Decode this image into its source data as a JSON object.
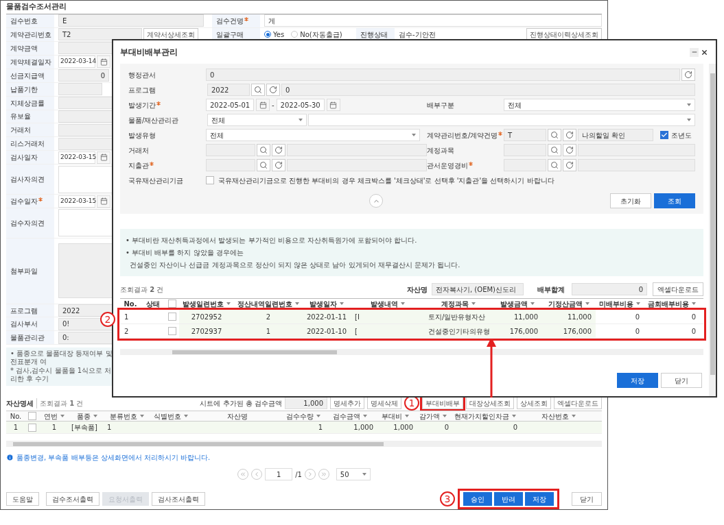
{
  "window": {
    "title": "물품검수조서관리"
  },
  "header_rows": [
    {
      "label": "검수번호",
      "value": "E",
      "right_label": "검수건명",
      "right_required": true,
      "right_value": "게"
    },
    {
      "label": "계약관리번호",
      "value": "T2",
      "button": "계약서상세조회",
      "right_label": "일괄구매",
      "options": [
        {
          "label": "Yes",
          "selected": true
        },
        {
          "label": "No(자동출급)",
          "selected": false
        }
      ],
      "status_label": "진행상태",
      "status_value": "검수-기안전",
      "status_button": "진행상태이력상세조회"
    }
  ],
  "fields": [
    {
      "label": "계약금액",
      "kind": "text",
      "required": false
    },
    {
      "label": "계약체결일자",
      "kind": "date",
      "value": "2022-03-14",
      "required": false
    },
    {
      "label": "선금지급액",
      "kind": "amount",
      "value": "0",
      "required": false
    },
    {
      "label": "납품기한",
      "kind": "short",
      "required": false
    },
    {
      "label": "지체상금률",
      "kind": "text",
      "required": false
    },
    {
      "label": "유보율",
      "kind": "text",
      "required": false
    },
    {
      "label": "거래처",
      "kind": "text",
      "required": false
    },
    {
      "label": "리스거래처",
      "kind": "text",
      "required": false
    },
    {
      "label": "검사일자",
      "kind": "date",
      "value": "2022-03-15",
      "required": false
    },
    {
      "label": "검사자의견",
      "kind": "textarea",
      "required": false
    },
    {
      "label": "검수일자",
      "kind": "date",
      "value": "2022-03-15",
      "required": true
    },
    {
      "label": "검수자의견",
      "kind": "textarea",
      "required": false
    },
    {
      "label": "첨부파일",
      "kind": "file",
      "required": false
    },
    {
      "label": "프로그램",
      "kind": "text",
      "value": "2022",
      "required": false
    },
    {
      "label": "검사부서",
      "kind": "text",
      "value": "0!",
      "required": false
    },
    {
      "label": "물품관리관",
      "kind": "text",
      "value": "0:",
      "required": false
    }
  ],
  "notes": [
    "• 품종으로 물품대장 등재여부 및 전표분개 여",
    "* 검사,검수시 물품을 1식으로 처리한 후 수기"
  ],
  "asset_section": {
    "title": "자산명세",
    "count": "조회결과 **1** 건",
    "total_label": "시트에 추가된 총 검수금액",
    "total_value": "1,000",
    "buttons": [
      "명세추가",
      "명세삭제",
      "부대비배부",
      "대장상세조회",
      "상세조회",
      "엑셀다운로드"
    ],
    "all_checked": false,
    "columns": [
      {
        "label": "No.",
        "sortable": false
      },
      {
        "label": "연번",
        "sortable": true
      },
      {
        "label": "품종",
        "sortable": true
      },
      {
        "label": "분류번호",
        "sortable": true
      },
      {
        "label": "식별번호",
        "sortable": true
      },
      {
        "label": "자산명",
        "sortable": false
      },
      {
        "label": "검수수량",
        "sortable": true
      },
      {
        "label": "검수금액",
        "sortable": true
      },
      {
        "label": "부대비",
        "sortable": true
      },
      {
        "label": "감가액",
        "sortable": true
      },
      {
        "label": "현재가치할인차금",
        "sortable": true
      },
      {
        "label": "자산번호",
        "sortable": true
      }
    ],
    "rows": [
      {
        "checked": false,
        "cells": [
          "1",
          "1",
          "[부속품]",
          "1",
          "",
          "",
          "1",
          "1,000",
          "1,000",
          "0",
          "0",
          ""
        ]
      }
    ],
    "info": "품종변경, 부속품 배부등은 상세화면에서 처리하시기 바랍니다.",
    "pagination": {
      "page": "1",
      "total": "/1",
      "page_size": "50"
    }
  },
  "footer": {
    "left_buttons": [
      {
        "label": "도움말",
        "disabled": false
      },
      {
        "label": "검수조서출력",
        "disabled": false
      },
      {
        "label": "요청서출력",
        "disabled": true
      },
      {
        "label": "검사조서출력",
        "disabled": false
      }
    ],
    "right_buttons": [
      {
        "label": "승인",
        "kind": "primary"
      },
      {
        "label": "반려",
        "kind": "primary"
      },
      {
        "label": "저장",
        "kind": "primary"
      },
      {
        "label": "닫기",
        "kind": "default"
      }
    ]
  },
  "dialog": {
    "title": "부대비배부관리",
    "search": {
      "office": {
        "label": "행정관서",
        "value": "0"
      },
      "program": {
        "label": "프로그램",
        "code": "2022",
        "name": "0"
      },
      "period": {
        "label": "발생기간",
        "required": true,
        "from": "2022-05-01",
        "separator": "-",
        "to": "2022-05-30"
      },
      "split": {
        "label": "배부구분",
        "value": "전체"
      },
      "manager": {
        "label": "물품/재산관리관",
        "value": "전체"
      },
      "type": {
        "label": "발생유형",
        "value": "전체"
      },
      "contract": {
        "label": "계약관리번호/계약건명",
        "required": true,
        "code": "T",
        "name": "나의할일 확인",
        "prev_year": {
          "label": "조년도",
          "checked": true
        }
      },
      "vendor": {
        "label": "거래처",
        "required": false
      },
      "account": {
        "label": "계정과목",
        "required": false
      },
      "payer": {
        "label": "지출관",
        "required": true
      },
      "expense": {
        "label": "관서운영경비",
        "required": true
      },
      "fund": {
        "label": "국유재산관리기금",
        "checked": false,
        "text": "국유재산관리기금으로 진행한 부대비의 경우 체크박스를 '체크상태'로 선택후 '지출관'을 선택하시기 바랍니다"
      },
      "reset_button": "초기화",
      "search_button": "조회"
    },
    "notice": [
      "• 부대비란 재산취득과정에서 발생되는 부가적인 비용으로 자산취득원가에 포함되어야 합니다.",
      "• 부대비 배부를 하지 않았을 경우에는",
      "건설중인 자산이나 선급금 계정과목으로 정산이 되지 않은 상태로 남아 있게되어 재무결산시 문제가 됩니다."
    ],
    "result_count": "조회결과 **2** 건",
    "all_checked": false,
    "asset_label": "자산명",
    "asset_value": "전자복사기, (OEM)신도리",
    "sum_label": "배부합계",
    "sum_value": "0",
    "excel_button": "엑셀다운로드",
    "columns": [
      {
        "label": "No.",
        "sortable": false
      },
      {
        "label": "상태",
        "sortable": false
      },
      {
        "label": "발생일련번호",
        "sortable": true
      },
      {
        "label": "정산내역일련번호",
        "sortable": true
      },
      {
        "label": "발생일자",
        "sortable": true
      },
      {
        "label": "발생내역",
        "sortable": true
      },
      {
        "label": "계정과목",
        "sortable": true
      },
      {
        "label": "발생금액",
        "sortable": true
      },
      {
        "label": "기정산금액",
        "sortable": true
      },
      {
        "label": "미배부비용",
        "sortable": true
      },
      {
        "label": "금회배부비용",
        "sortable": true
      }
    ],
    "rows": [
      {
        "checked": false,
        "cells": [
          "1",
          "",
          "2702952",
          "2",
          "2022-01-11",
          "[I",
          "토지/일반유형자산",
          "11,000",
          "11,000",
          "0",
          "0"
        ]
      },
      {
        "checked": false,
        "cells": [
          "2",
          "",
          "2702937",
          "1",
          "2022-01-10",
          "[",
          "건설중인기타의유형",
          "176,000",
          "176,000",
          "0",
          "0"
        ]
      }
    ],
    "buttons": [
      {
        "label": "저장",
        "kind": "primary"
      },
      {
        "label": "닫기",
        "kind": "default"
      }
    ]
  },
  "callouts": [
    {
      "number": "1"
    },
    {
      "number": "2"
    },
    {
      "number": "3"
    }
  ]
}
